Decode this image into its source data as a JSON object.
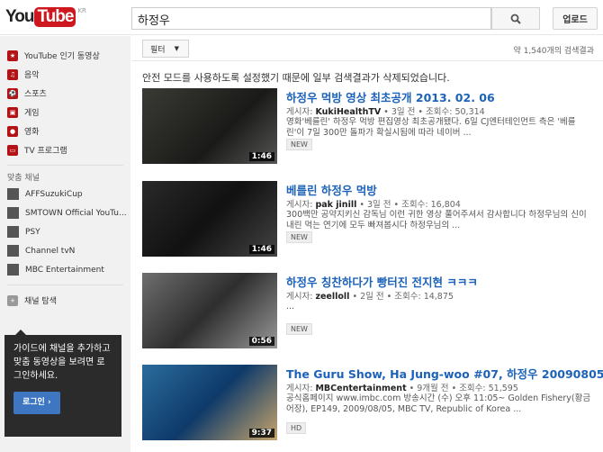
{
  "header": {
    "logo_you": "You",
    "logo_tube": "Tube",
    "region": "KR",
    "search_value": "하정우",
    "upload": "업로드"
  },
  "sidebar": {
    "items": [
      {
        "label": "YouTube 인기 동영상",
        "glyph": "★"
      },
      {
        "label": "음악",
        "glyph": "♫"
      },
      {
        "label": "스포츠",
        "glyph": "⚽"
      },
      {
        "label": "게임",
        "glyph": "▣"
      },
      {
        "label": "영화",
        "glyph": "●"
      },
      {
        "label": "TV 프로그램",
        "glyph": "▭"
      }
    ],
    "channels_title": "맞춤 채널",
    "channels": [
      {
        "label": "AFFSuzukiCup"
      },
      {
        "label": "SMTOWN Official YouTu..."
      },
      {
        "label": "PSY"
      },
      {
        "label": "Channel tvN"
      },
      {
        "label": "MBC Entertainment"
      }
    ],
    "browse": "채널 탐색",
    "tip": "가이드에 채널을 추가하고 맞춤 동영상을 보려면 로그인하세요.",
    "login": "로그인 ›"
  },
  "results": {
    "filter": "필터",
    "count": "약 1,540개의 검색결과",
    "notice": "안전 모드를 사용하도록 설정했기 때문에 일부 검색결과가 삭제되었습니다.",
    "videos": [
      {
        "title": "하정우 먹방 영상 최초공개 2013. 02. 06",
        "meta_prefix": "게시자: ",
        "channel": "KukiHealthTV",
        "meta_rest": " • 3일 전 • 조회수: 50,314",
        "desc": "영화'베를린' 하정우 먹방 편집영상 최초공개됐다. 6일 CJ엔터테인먼트 측은 '베를린'이 7일 300만 돌파가 확실시됨에 따라 네이버 ...",
        "tag": "NEW",
        "duration": "1:46"
      },
      {
        "title": "베를린 하정우 먹방",
        "meta_prefix": "게시자: ",
        "channel": "pak jinill",
        "meta_rest": " • 3일 전 • 조회수: 16,804",
        "desc": "300백만 공약지키신 감독님 이런 귀한 영상 풀어주셔서 감사합니다 하정우님의 신이 내린 먹는 연기에 모두 빠져봅시다 하정우님의 ...",
        "tag": "NEW",
        "duration": "1:46"
      },
      {
        "title": "하정우 칭찬하다가 빵터진 전지현 ㅋㅋㅋ",
        "meta_prefix": "게시자: ",
        "channel": "zeelloll",
        "meta_rest": " • 2일 전 • 조회수: 14,875",
        "desc": "...",
        "tag": "NEW",
        "duration": "0:56"
      },
      {
        "title": "The Guru Show, Ha Jung-woo #07, 하정우 20090805",
        "meta_prefix": "게시자: ",
        "channel": "MBCentertainment",
        "meta_rest": " • 9개월 전 • 조회수: 51,595",
        "desc": "공식홈페이지 www.imbc.com 방송시간 (수) 오후 11:05~ Golden Fishery(황금어장), EP149, 2009/08/05, MBC TV, Republic of Korea ...",
        "tag": "HD",
        "duration": "9:37"
      }
    ]
  }
}
